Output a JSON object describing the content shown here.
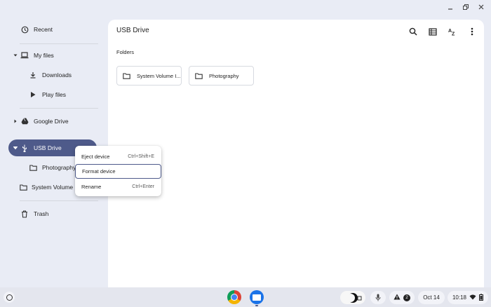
{
  "window": {
    "controls": [
      "minimize-icon",
      "restore-icon",
      "close-icon"
    ]
  },
  "sidebar": {
    "recent": "Recent",
    "my_files": "My files",
    "downloads": "Downloads",
    "play_files": "Play files",
    "google_drive": "Google Drive",
    "usb_drive": "USB Drive",
    "photography": "Photography",
    "system_volume": "System Volume Information",
    "trash": "Trash"
  },
  "main": {
    "title": "USB Drive",
    "folders_label": "Folders",
    "folders": [
      "System Volume I...",
      "Photography"
    ]
  },
  "context_menu": {
    "items": [
      {
        "label": "Eject device",
        "shortcut": "Ctrl+Shift+E"
      },
      {
        "label": "Format device",
        "shortcut": ""
      },
      {
        "label": "Rename",
        "shortcut": "Ctrl+Enter"
      }
    ]
  },
  "shelf": {
    "date": "Oct 14",
    "time": "10:18",
    "notification_count": "2"
  },
  "colors": {
    "accent": "#4e5a8a",
    "background": "#e9ecf5"
  }
}
